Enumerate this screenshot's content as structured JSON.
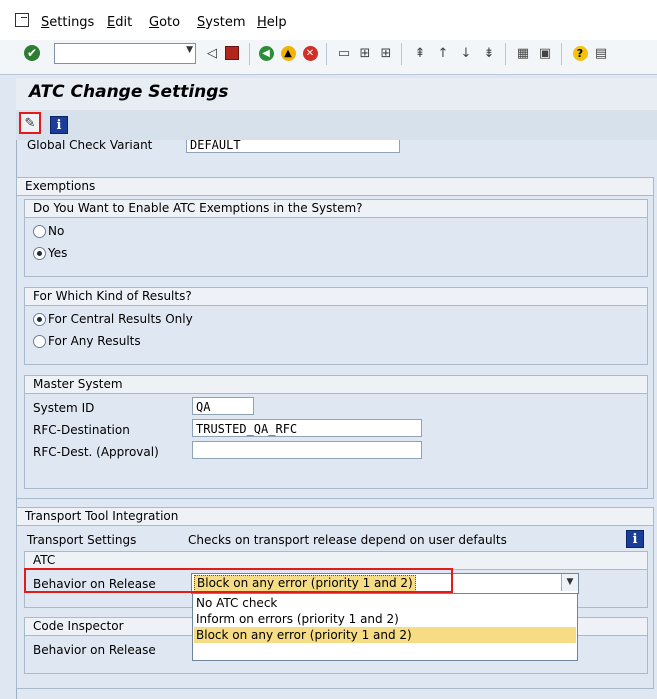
{
  "menu": [
    "Settings",
    "Edit",
    "Goto",
    "System",
    "Help"
  ],
  "toolbar": {
    "command_field_value": ""
  },
  "title": "ATC Change Settings",
  "global_check": {
    "label": "Global Check Variant",
    "value": "DEFAULT"
  },
  "exemptions": {
    "title": "Exemptions",
    "enable": {
      "title": "Do You Want to Enable ATC Exemptions in the System?",
      "options": [
        "No",
        "Yes"
      ],
      "selected": "Yes"
    },
    "results": {
      "title": "For Which Kind of Results?",
      "options": [
        "For Central Results Only",
        "For Any Results"
      ],
      "selected": "For Central Results Only"
    },
    "master": {
      "title": "Master System",
      "fields": [
        {
          "label": "System ID",
          "value": "QA"
        },
        {
          "label": "RFC-Destination",
          "value": "TRUSTED_QA_RFC"
        },
        {
          "label": "RFC-Dest. (Approval)",
          "value": ""
        }
      ]
    }
  },
  "transport": {
    "title": "Transport Tool Integration",
    "settings_label": "Transport Settings",
    "settings_value": "Checks on transport release depend on user defaults",
    "atc": {
      "title": "ATC",
      "behavior_label": "Behavior on Release",
      "behavior_value": "Block on any error (priority 1 and 2)"
    },
    "code_inspector": {
      "title": "Code Inspector",
      "behavior_label": "Behavior on Release"
    }
  },
  "dropdown": {
    "options": [
      "No ATC check",
      "Inform on errors (priority 1 and 2)",
      "Block on any error (priority 1 and 2)"
    ],
    "selected": "Block on any error (priority 1 and 2)"
  },
  "colors": {
    "highlight_red": "#e21b1b",
    "selected_yellow": "#f6dc84",
    "info_blue": "#1a3d9a"
  }
}
